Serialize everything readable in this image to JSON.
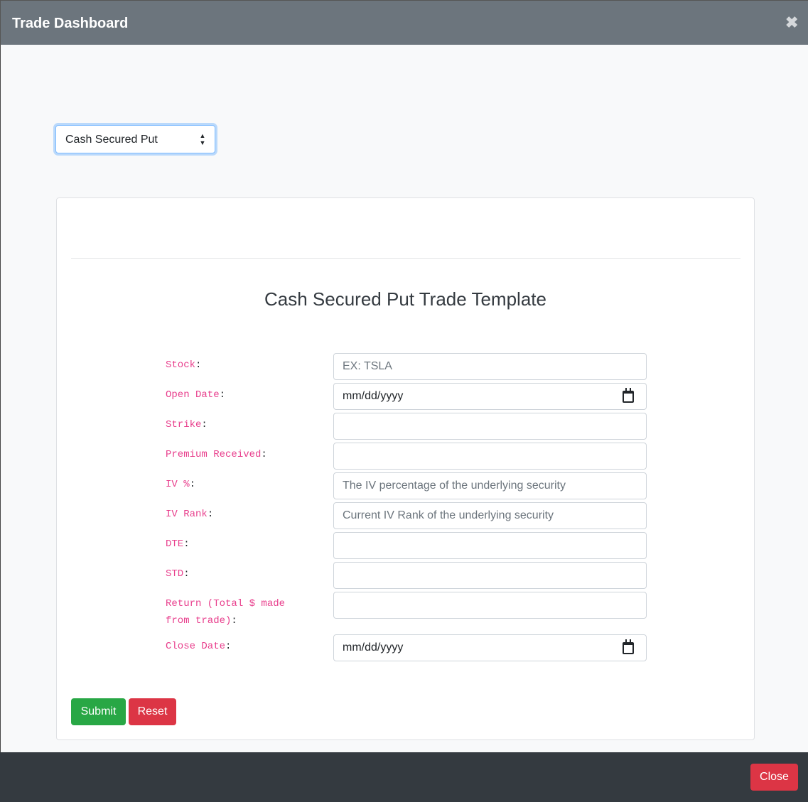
{
  "header": {
    "title": "Trade Dashboard",
    "close_glyph": "✖"
  },
  "trade_select": {
    "selected": "Cash Secured Put"
  },
  "form": {
    "title": "Cash Secured Put Trade Template",
    "fields": [
      {
        "label": "Stock",
        "placeholder": "EX: TSLA",
        "type": "text"
      },
      {
        "label": "Open Date",
        "placeholder": "mm/dd/yyyy",
        "type": "date"
      },
      {
        "label": "Strike",
        "placeholder": "",
        "type": "text"
      },
      {
        "label": "Premium Received",
        "placeholder": "",
        "type": "text"
      },
      {
        "label": "IV %",
        "placeholder": "The IV percentage of the underlying security",
        "type": "text"
      },
      {
        "label": "IV Rank",
        "placeholder": "Current IV Rank of the underlying security",
        "type": "text"
      },
      {
        "label": "DTE",
        "placeholder": "",
        "type": "text"
      },
      {
        "label": "STD",
        "placeholder": "",
        "type": "text"
      },
      {
        "label": "Return (Total $ made from trade)",
        "placeholder": "",
        "type": "text"
      },
      {
        "label": "Close Date",
        "placeholder": "mm/dd/yyyy",
        "type": "date"
      }
    ],
    "label_suffix": ":",
    "submit_label": "Submit",
    "reset_label": "Reset"
  },
  "footer": {
    "close_label": "Close"
  }
}
